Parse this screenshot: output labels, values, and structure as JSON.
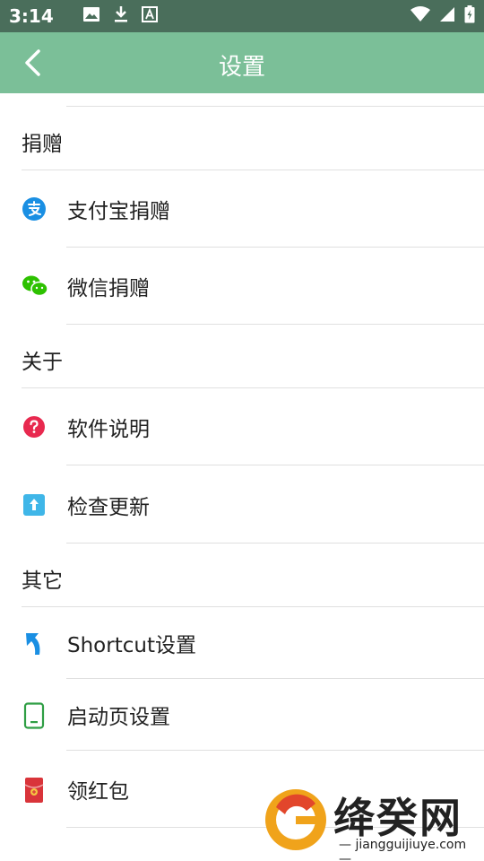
{
  "status_bar": {
    "time": "3:14"
  },
  "app_bar": {
    "title": "设置"
  },
  "sections": [
    {
      "header": "捐赠",
      "items": [
        {
          "label": "支付宝捐赠",
          "icon": "alipay-icon"
        },
        {
          "label": "微信捐赠",
          "icon": "wechat-icon"
        }
      ]
    },
    {
      "header": "关于",
      "items": [
        {
          "label": "软件说明",
          "icon": "help-icon"
        },
        {
          "label": "检查更新",
          "icon": "update-icon"
        }
      ]
    },
    {
      "header": "其它",
      "items": [
        {
          "label": "Shortcut设置",
          "icon": "shortcut-icon"
        },
        {
          "label": "启动页设置",
          "icon": "phone-icon"
        },
        {
          "label": "领红包",
          "icon": "red-envelope-icon"
        }
      ]
    }
  ],
  "watermark": {
    "brand": "绛癸网",
    "url": "jiangguijiuye.com"
  },
  "colors": {
    "status_bar": "#4a6e5b",
    "app_bar": "#7bbf98",
    "alipay": "#1a8fe3",
    "wechat": "#2dc100",
    "help": "#e8294f",
    "update": "#3fb6e8",
    "shortcut": "#1a8fe3",
    "phone": "#2f9e44",
    "red_envelope": "#d9343a"
  }
}
